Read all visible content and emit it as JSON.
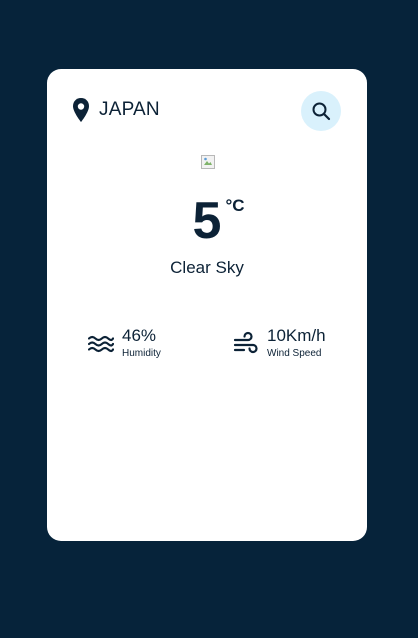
{
  "location": {
    "name": "JAPAN",
    "icon": "map-pin-icon"
  },
  "search": {
    "icon": "search-icon"
  },
  "weather": {
    "icon": "broken-image-icon",
    "temperature": "5",
    "unit": "°C",
    "description": "Clear Sky"
  },
  "stats": {
    "humidity": {
      "value": "46%",
      "label": "Humidity",
      "icon": "waves-icon"
    },
    "wind": {
      "value": "10Km/h",
      "label": "Wind Speed",
      "icon": "wind-icon"
    }
  },
  "colors": {
    "background": "#06233a",
    "card": "#ffffff",
    "text": "#0c2236",
    "search_bg": "#d9f1fc"
  }
}
